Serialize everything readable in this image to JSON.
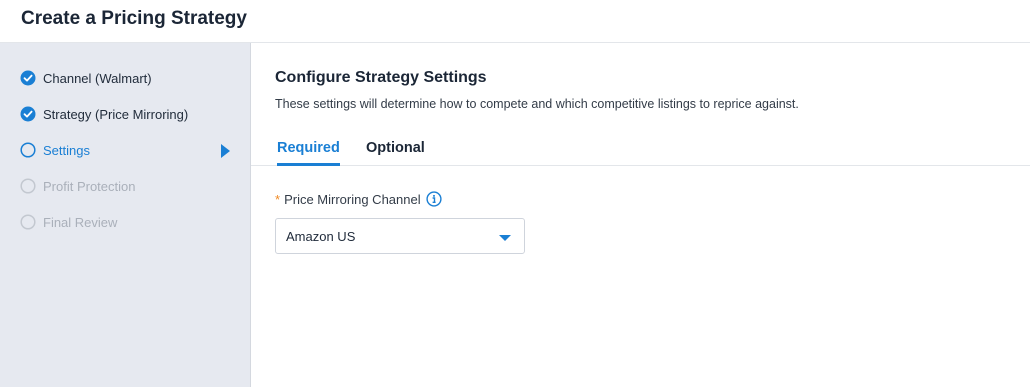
{
  "header": {
    "title": "Create a Pricing Strategy"
  },
  "steps": [
    {
      "label": "Channel (Walmart)",
      "status": "done"
    },
    {
      "label": "Strategy (Price Mirroring)",
      "status": "done"
    },
    {
      "label": "Settings",
      "status": "active"
    },
    {
      "label": "Profit Protection",
      "status": "pending"
    },
    {
      "label": "Final Review",
      "status": "pending"
    }
  ],
  "main": {
    "title": "Configure Strategy Settings",
    "description": "These settings will determine how to compete and which competitive listings to reprice against.",
    "tabs": [
      {
        "label": "Required",
        "active": true
      },
      {
        "label": "Optional",
        "active": false
      }
    ],
    "field": {
      "required_marker": "*",
      "label": "Price Mirroring Channel",
      "info_icon": "info-icon",
      "value": "Amazon US"
    }
  },
  "colors": {
    "accent": "#1a7fd4",
    "sidebar_bg": "#e6e9f0",
    "required_star": "#f08a24",
    "pending": "#aab0ba"
  }
}
